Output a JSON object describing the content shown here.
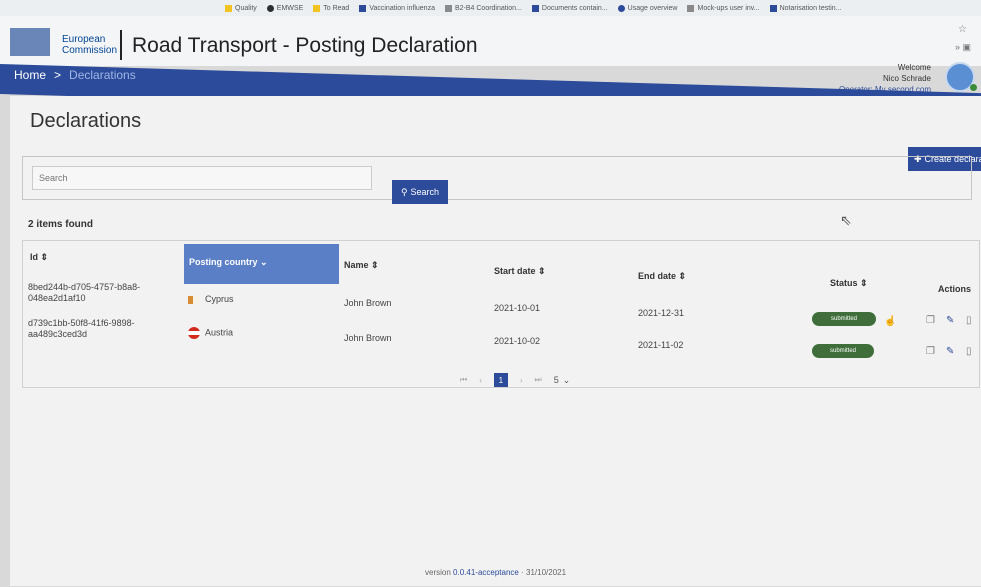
{
  "bookmarks": [
    {
      "label": "Quality",
      "color": "#f3c322"
    },
    {
      "label": "EMWSE",
      "color": "#2e2e2e"
    },
    {
      "label": "To Read",
      "color": "#f3c322"
    },
    {
      "label": "Vaccination influenza",
      "color": "#2c4b9a"
    },
    {
      "label": "B2-B4 Coordination...",
      "color": "#8a8a8a"
    },
    {
      "label": "Documents contain...",
      "color": "#2c4b9a"
    },
    {
      "label": "Usage overview",
      "color": "#2c4b9a"
    },
    {
      "label": "Mock-ups user inv...",
      "color": "#8a8a8a"
    },
    {
      "label": "Notarisation testin...",
      "color": "#2c4b9a"
    }
  ],
  "header": {
    "logo_line1": "European",
    "logo_line2": "Commission",
    "app_title": "Road Transport - Posting Declaration"
  },
  "nav": {
    "home": "Home",
    "separator": ">",
    "current": "Declarations"
  },
  "user": {
    "welcome": "Welcome",
    "name": "Nico Schrade",
    "operator": "Operator: My second com"
  },
  "page": {
    "title": "Declarations",
    "create_button": "Create declara",
    "search_placeholder": "Search",
    "search_button": "Search",
    "items_found": "2 items found"
  },
  "table": {
    "headers": {
      "id": "Id ⇕",
      "posting_country": "Posting country ⌄",
      "name": "Name ⇕",
      "start_date": "Start date ⇕",
      "end_date": "End date ⇕",
      "status": "Status ⇕",
      "actions": "Actions"
    },
    "rows": [
      {
        "id_line1": "8bed244b-d705-4757-b8a8-",
        "id_line2": "048ea2d1af10",
        "country": "Cyprus",
        "name": "John Brown",
        "start_date": "2021-10-01",
        "end_date": "2021-12-31",
        "status": "submitted"
      },
      {
        "id_line1": "d739c1bb-50f8-41f6-9898-",
        "id_line2": "aa489c3ced3d",
        "country": "Austria",
        "name": "John Brown",
        "start_date": "2021-10-02",
        "end_date": "2021-11-02",
        "status": "submitted"
      }
    ]
  },
  "pagination": {
    "first": "⏮",
    "prev": "‹",
    "current_page": "1",
    "next": "›",
    "last": "⏭",
    "page_size": "5"
  },
  "footer": {
    "prefix": "version",
    "version": "0.0.41-acceptance",
    "date": "31/10/2021"
  },
  "colors": {
    "primary": "#2c4b9a",
    "active_header": "#5b7fc7",
    "status_submitted": "#3f6e3b"
  }
}
